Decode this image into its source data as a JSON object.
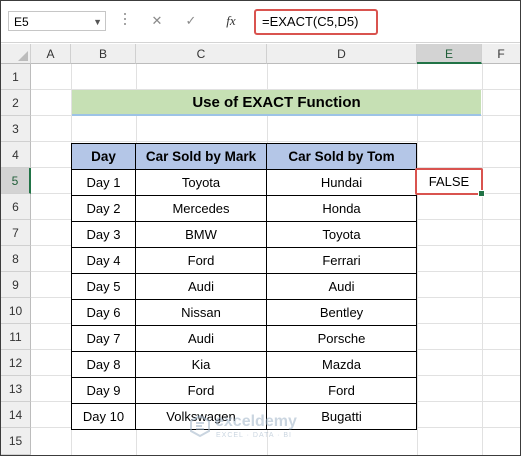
{
  "formula_bar": {
    "name_box": "E5",
    "cancel_symbol": "✕",
    "enter_symbol": "✓",
    "function_symbol": "fx",
    "formula": "=EXACT(C5,D5)"
  },
  "columns": [
    "A",
    "B",
    "C",
    "D",
    "E",
    "F"
  ],
  "selected_column": "E",
  "rows": [
    "1",
    "2",
    "3",
    "4",
    "5",
    "6",
    "7",
    "8",
    "9",
    "10",
    "11",
    "12",
    "13",
    "14",
    "15"
  ],
  "selected_row": "5",
  "title": "Use of EXACT Function",
  "table": {
    "headers": [
      "Day",
      "Car Sold by Mark",
      "Car Sold by Tom"
    ],
    "rows": [
      [
        "Day 1",
        "Toyota",
        "Hundai"
      ],
      [
        "Day 2",
        "Mercedes",
        "Honda"
      ],
      [
        "Day 3",
        "BMW",
        "Toyota"
      ],
      [
        "Day 4",
        "Ford",
        "Ferrari"
      ],
      [
        "Day 5",
        "Audi",
        "Audi"
      ],
      [
        "Day 6",
        "Nissan",
        "Bentley"
      ],
      [
        "Day 7",
        "Audi",
        "Porsche"
      ],
      [
        "Day 8",
        "Kia",
        "Mazda"
      ],
      [
        "Day 9",
        "Ford",
        "Ford"
      ],
      [
        "Day 10",
        "Volkswagen",
        "Bugatti"
      ]
    ]
  },
  "result_cell": "FALSE",
  "watermark": {
    "name": "exceldemy",
    "tagline": "EXCEL · DATA · BI"
  },
  "colors": {
    "title_fill": "#c6e0b4",
    "header_fill": "#b4c6e7",
    "highlight_border": "#d9534f",
    "selection_green": "#217346"
  }
}
